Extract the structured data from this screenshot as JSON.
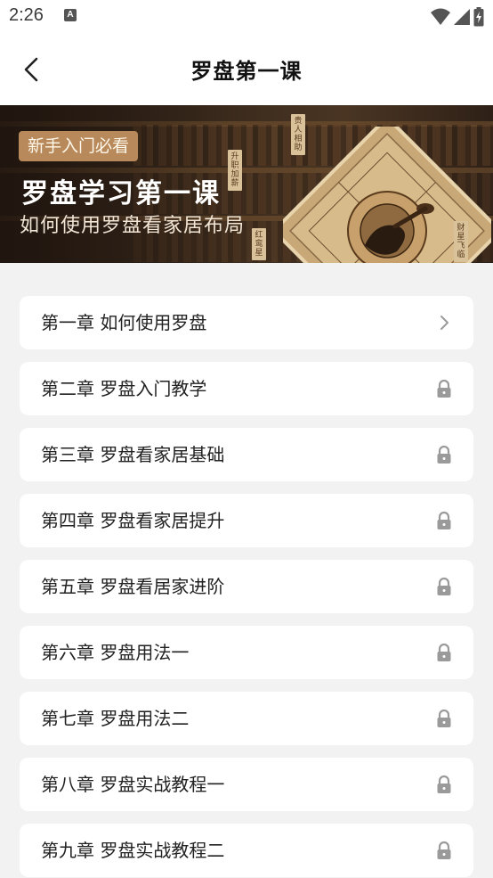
{
  "status_bar": {
    "time": "2:26",
    "notification_icon": "a-icon",
    "icons": [
      "wifi-icon",
      "cellular-signal-icon",
      "battery-icon"
    ]
  },
  "header": {
    "title": "罗盘第一课",
    "back_icon": "chevron-left-icon"
  },
  "banner": {
    "tag": "新手入门必看",
    "title": "罗盘学习第一课",
    "subtitle": "如何使用罗盘看家居布局",
    "image": "luopan-compass-illustration",
    "plates": [
      "贵人相助",
      "升职加薪",
      "红鸾星",
      "财星飞临"
    ]
  },
  "chapters": [
    {
      "label": "第一章 如何使用罗盘",
      "status": "unlocked",
      "icon": "chevron-right-icon"
    },
    {
      "label": "第二章 罗盘入门教学",
      "status": "locked",
      "icon": "lock-icon"
    },
    {
      "label": "第三章 罗盘看家居基础",
      "status": "locked",
      "icon": "lock-icon"
    },
    {
      "label": "第四章 罗盘看家居提升",
      "status": "locked",
      "icon": "lock-icon"
    },
    {
      "label": "第五章 罗盘看居家进阶",
      "status": "locked",
      "icon": "lock-icon"
    },
    {
      "label": "第六章 罗盘用法一",
      "status": "locked",
      "icon": "lock-icon"
    },
    {
      "label": "第七章 罗盘用法二",
      "status": "locked",
      "icon": "lock-icon"
    },
    {
      "label": "第八章 罗盘实战教程一",
      "status": "locked",
      "icon": "lock-icon"
    },
    {
      "label": "第九章 罗盘实战教程二",
      "status": "locked",
      "icon": "lock-icon"
    }
  ],
  "colors": {
    "background": "#f2f2f2",
    "card": "#ffffff",
    "text": "#222222",
    "icon_gray": "#9a9a9a",
    "banner_tag": "#b8895a"
  }
}
